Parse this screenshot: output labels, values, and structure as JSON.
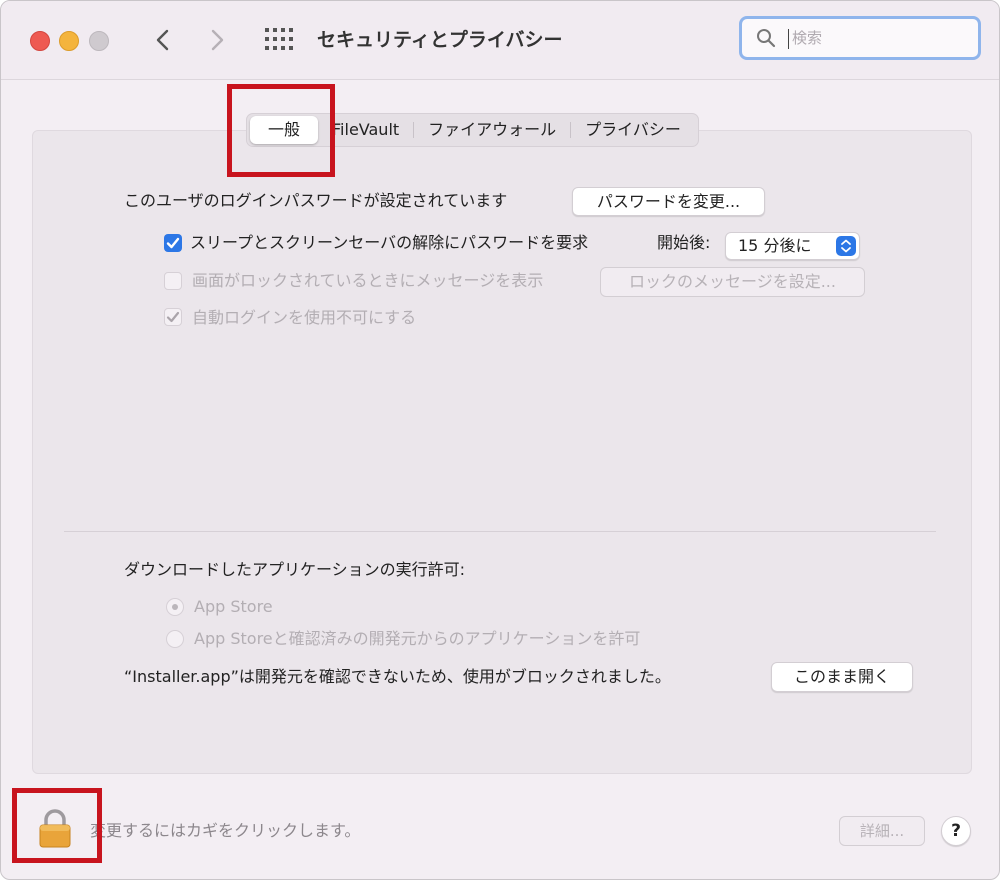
{
  "window": {
    "title": "セキュリティとプライバシー"
  },
  "search": {
    "placeholder": "検索"
  },
  "tabs": [
    {
      "label": "一般",
      "selected": true
    },
    {
      "label": "FileVault",
      "selected": false
    },
    {
      "label": "ファイアウォール",
      "selected": false
    },
    {
      "label": "プライバシー",
      "selected": false
    }
  ],
  "general": {
    "password_set_text": "このユーザのログインパスワードが設定されています",
    "change_password_button": "パスワードを変更...",
    "require_password": {
      "label": "スリープとスクリーンセーバの解除にパスワードを要求",
      "checked": true
    },
    "start_after_label": "開始後:",
    "start_after_value": "15 分後に",
    "show_message": {
      "label": "画面がロックされているときにメッセージを表示",
      "checked": false,
      "enabled": false
    },
    "set_lock_message_button": "ロックのメッセージを設定...",
    "disable_auto_login": {
      "label": "自動ログインを使用不可にする",
      "checked": true,
      "enabled": false
    }
  },
  "downloads": {
    "heading": "ダウンロードしたアプリケーションの実行許可:",
    "options": [
      {
        "label": "App Store",
        "selected": true,
        "enabled": false
      },
      {
        "label": "App Storeと確認済みの開発元からのアプリケーションを許可",
        "selected": false,
        "enabled": false
      }
    ],
    "blocked_message": "“Installer.app”は開発元を確認できないため、使用がブロックされました。",
    "open_anyway_button": "このまま開く"
  },
  "footer": {
    "lock_text": "変更するにはカギをクリックします。",
    "advanced_button": "詳細...",
    "help_label": "?"
  },
  "colors": {
    "accent": "#2c77e6",
    "annotation_red": "#c8141e",
    "lock_gold": "#e9a43a"
  }
}
